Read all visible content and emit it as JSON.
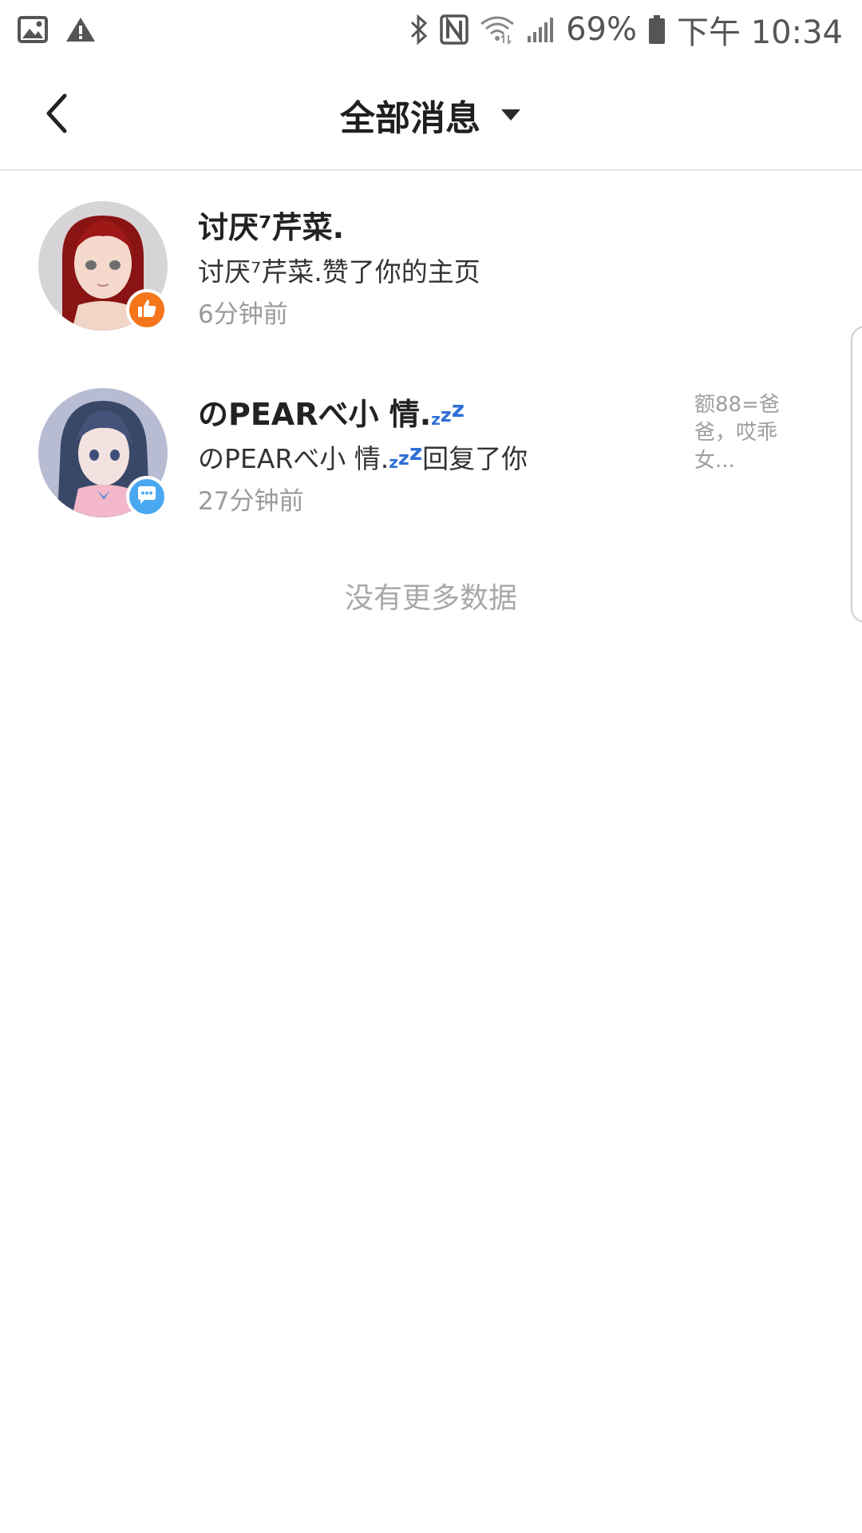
{
  "status_bar": {
    "battery_text": "69%",
    "time_text": "下午 10:34",
    "icons": [
      "image-icon",
      "warning-icon",
      "bluetooth-icon",
      "nfc-icon",
      "wifi-icon",
      "signal-icon",
      "battery-icon"
    ]
  },
  "header": {
    "title": "全部消息",
    "back_icon": "chevron-left-icon",
    "dropdown_icon": "caret-down-icon"
  },
  "messages": [
    {
      "name": "讨厌⁷芹菜.",
      "text": "讨厌⁷芹菜.赞了你的主页",
      "time": "6分钟前",
      "badge": "like",
      "badge_color": "#f5761a",
      "preview": ""
    },
    {
      "name": "のPEARべ小 情.",
      "name_suffix": "zzz",
      "text_name": "のPEARべ小 情.",
      "text_suffix": "zzz",
      "text_action": "回复了你",
      "time": "27分钟前",
      "badge": "comment",
      "badge_color": "#4aa8f0",
      "preview": "额88=爸爸，哎乖女..."
    }
  ],
  "footer": {
    "no_more": "没有更多数据"
  }
}
